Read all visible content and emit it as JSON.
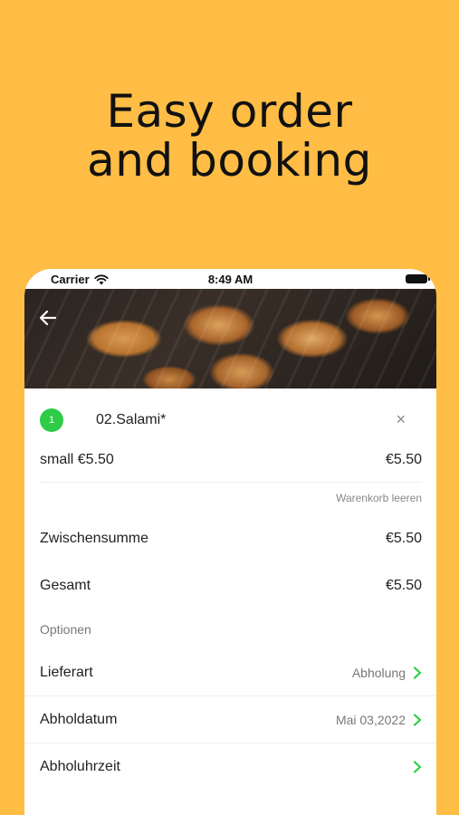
{
  "headline": {
    "line1": "Easy order",
    "line2": "and booking"
  },
  "status_bar": {
    "carrier": "Carrier",
    "time": "8:49 AM"
  },
  "cart": {
    "item": {
      "quantity": "1",
      "name": "02.Salami*",
      "remove_symbol": "×"
    },
    "size": {
      "label": "small €5.50",
      "price": "€5.50"
    },
    "clear_label": "Warenkorb leeren"
  },
  "totals": {
    "subtotal_label": "Zwischensumme",
    "subtotal_value": "€5.50",
    "total_label": "Gesamt",
    "total_value": "€5.50"
  },
  "options": {
    "section_label": "Optionen",
    "rows": [
      {
        "label": "Lieferart",
        "value": "Abholung"
      },
      {
        "label": "Abholdatum",
        "value": "Mai 03,2022"
      },
      {
        "label": "Abholuhrzeit",
        "value": ""
      }
    ]
  },
  "colors": {
    "background": "#FFBD45",
    "accent": "#2ECC47"
  },
  "icons": {
    "back": "arrow-left-icon",
    "wifi": "wifi-icon",
    "battery": "battery-icon",
    "chevron": "chevron-right-icon"
  }
}
